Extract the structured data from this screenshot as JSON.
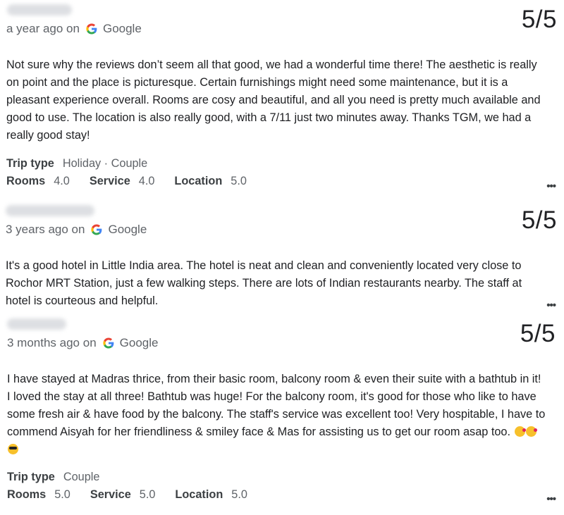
{
  "reviews": [
    {
      "time": "a year ago on",
      "source": "Google",
      "score": "5/5",
      "text": "Not sure why the reviews don’t seem all that good, we had a wonderful time there! The aesthetic is really on point and the place is picturesque. Certain furnishings might need some maintenance, but it is a pleasant experience overall. Rooms are cosy and beautiful, and all you need is pretty much available and good to use. The location is also really good, with a 7/11 just two minutes away. Thanks TGM, we had a really good stay!",
      "trip_type_label": "Trip type",
      "trip_type": "Holiday · Couple",
      "ratings": [
        {
          "label": "Rooms",
          "value": "4.0"
        },
        {
          "label": "Service",
          "value": "4.0"
        },
        {
          "label": "Location",
          "value": "5.0"
        }
      ],
      "more": "•••"
    },
    {
      "time": "3 years ago on",
      "source": "Google",
      "score": "5/5",
      "text": "It's a good hotel in Little India area. The hotel is neat and clean and conveniently located very close to Rochor MRT Station, just a few walking steps. There are lots of Indian restaurants nearby. The staff at hotel is courteous and helpful.",
      "more": "•••"
    },
    {
      "time": "3 months ago on",
      "source": "Google",
      "score": "5/5",
      "text": "I have stayed at Madras thrice, from their basic room, balcony room & even their suite with a bathtub in it! I loved the stay at all three! Bathtub was huge! For the balcony room, it's good for those who like to have some fresh air & have food by the balcony. The staff's service was excellent too! Very hospitable, I have to commend Aisyah for her friendliness & smiley face & Mas for assisting us to get our room asap too.",
      "trip_type_label": "Trip type",
      "trip_type": "Couple",
      "ratings": [
        {
          "label": "Rooms",
          "value": "5.0"
        },
        {
          "label": "Service",
          "value": "5.0"
        },
        {
          "label": "Location",
          "value": "5.0"
        }
      ],
      "more": "•••"
    }
  ],
  "icons": {
    "google": "google-g-icon",
    "more": "more-options-icon"
  },
  "colors": {
    "google_blue": "#4285F4",
    "google_red": "#EA4335",
    "google_yellow": "#FBBC05",
    "google_green": "#34A853"
  }
}
